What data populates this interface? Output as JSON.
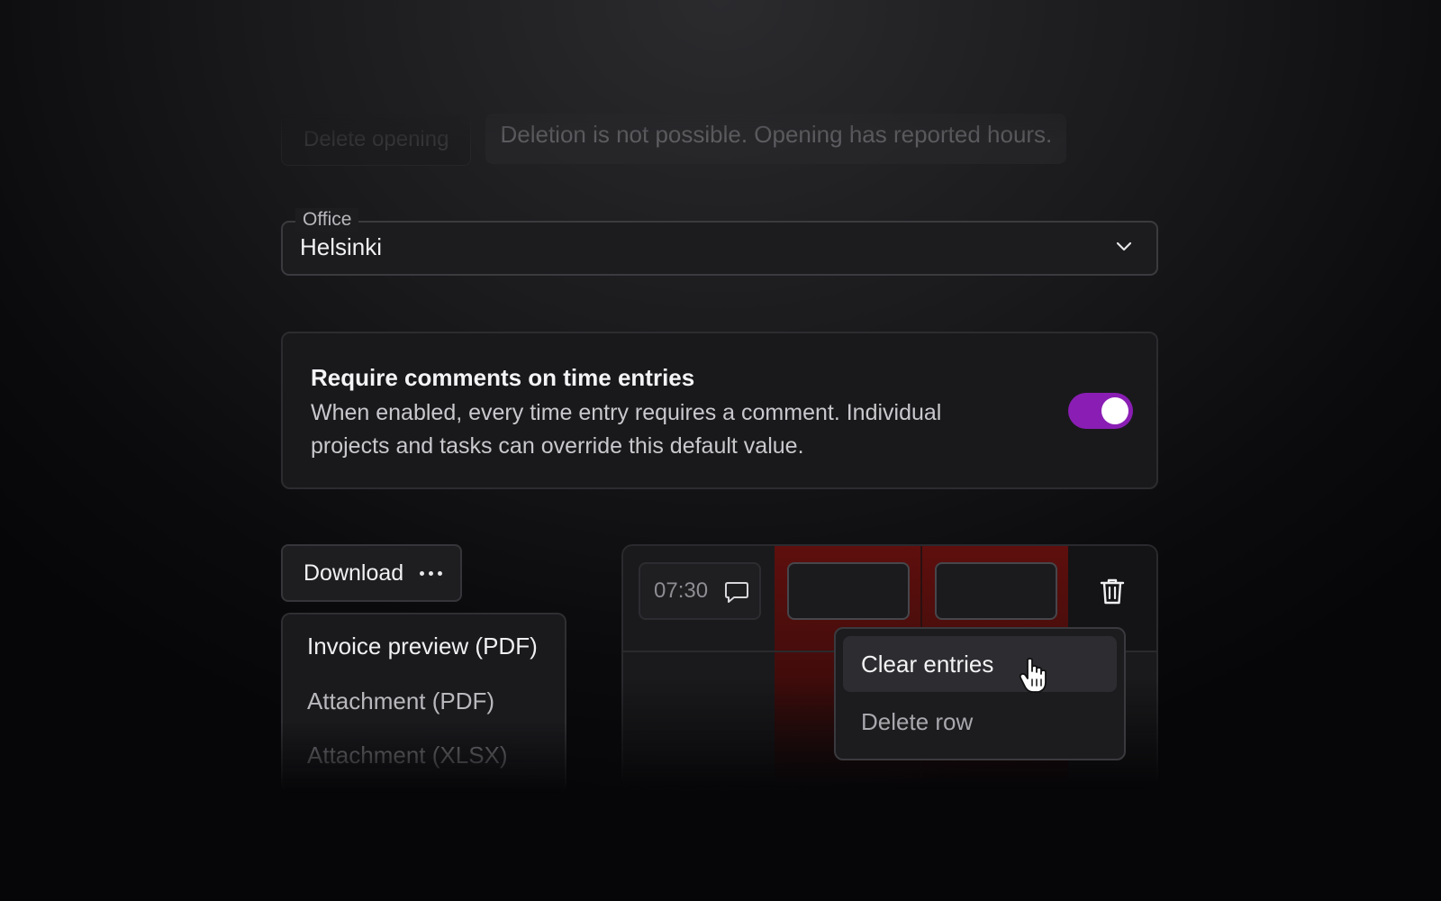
{
  "delete_opening": {
    "button_label": "Delete opening",
    "tooltip": "Deletion is not possible. Opening has reported hours."
  },
  "office": {
    "label": "Office",
    "value": "Helsinki",
    "icon": "chevron-down-icon"
  },
  "comments_setting": {
    "title": "Require comments on time entries",
    "description": "When enabled, every time entry requires a comment. Individual projects and tasks can override this default value.",
    "enabled": true,
    "toggle_color": "#8a1eb4"
  },
  "download": {
    "button_label": "Download",
    "menu_items": [
      "Invoice preview (PDF)",
      "Attachment (PDF)",
      "Attachment (XLSX)"
    ]
  },
  "time_grid": {
    "entry_time": "07:30",
    "highlight_color": "#5e0f0d",
    "context_menu": {
      "items": [
        "Clear entries",
        "Delete row"
      ],
      "hovered": "Clear entries"
    }
  }
}
